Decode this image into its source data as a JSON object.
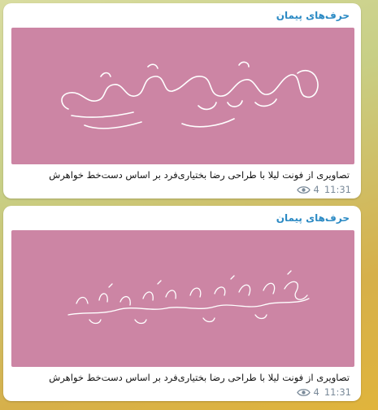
{
  "messages": [
    {
      "author": "حرف‌های پیمان",
      "image_description": "pink card with white handwritten calligraphy",
      "caption": "تصاویری از فونت لیلا با طراحی رضا بختیاری‌فرد بر اساس دست‌خط خواهرش",
      "views": "4",
      "time": "11:31"
    },
    {
      "author": "حرف‌های پیمان",
      "image_description": "pink card with white ornate calligraphy",
      "caption": "تصاویری از فونت لیلا با طراحی رضا بختیاری‌فرد بر اساس دست‌خط خواهرش",
      "views": "4",
      "time": "11:31"
    }
  ],
  "colors": {
    "photo_background": "#cc85a4",
    "author": "#2b8ac4",
    "meta": "#7a8a99"
  },
  "icons": [
    "eye-icon"
  ]
}
